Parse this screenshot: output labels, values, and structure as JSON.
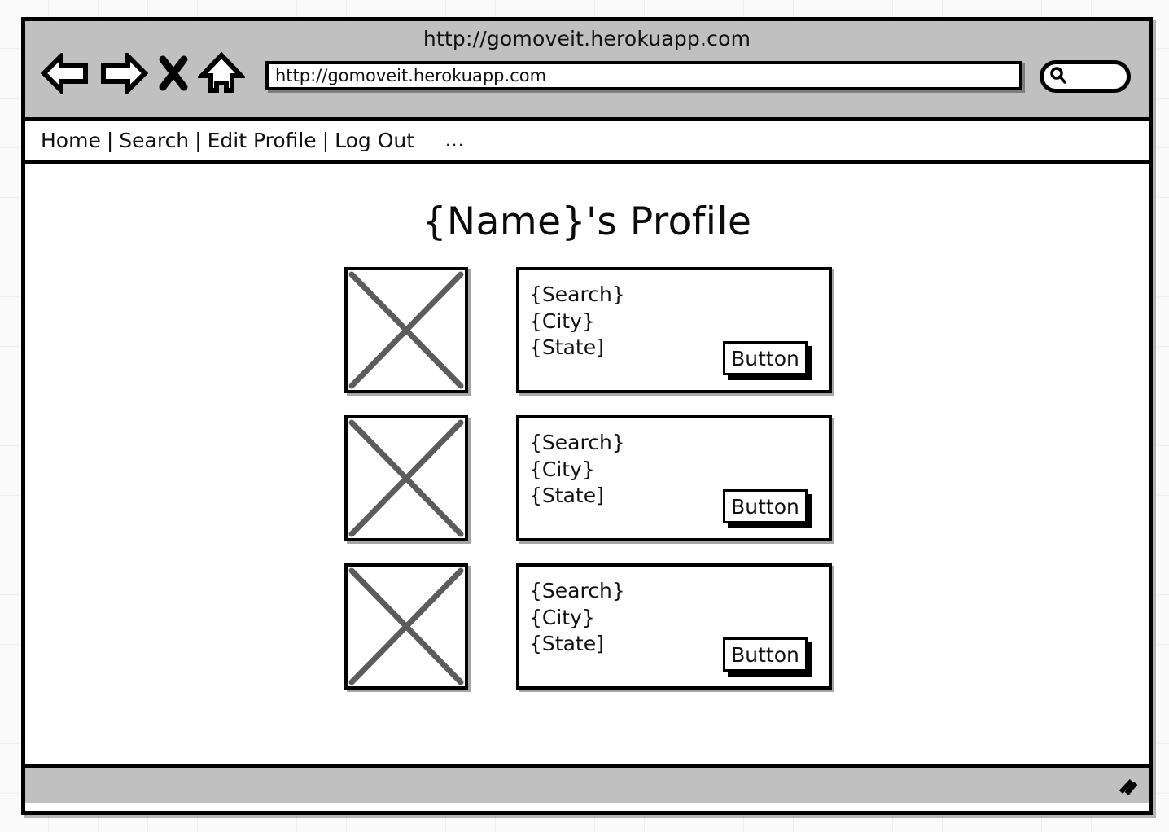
{
  "browser": {
    "window_title": "http://gomoveit.herokuapp.com",
    "address_bar": {
      "value": "http://gomoveit.herokuapp.com",
      "placeholder": "http://"
    },
    "search_box": {
      "value": "",
      "placeholder": ""
    },
    "toolbar_icons": [
      {
        "name": "back-arrow-icon",
        "label": "Back"
      },
      {
        "name": "forward-arrow-icon",
        "label": "Forward"
      },
      {
        "name": "stop-x-icon",
        "label": "Stop"
      },
      {
        "name": "home-icon",
        "label": "Home"
      }
    ],
    "status_bar": {
      "text": "",
      "resize_grip": "resize-grip-icon"
    }
  },
  "site_nav": {
    "separator": "|",
    "items": [
      {
        "label": "Home"
      },
      {
        "label": "Search"
      },
      {
        "label": "Edit Profile"
      },
      {
        "label": "Log Out"
      }
    ],
    "overflow": "..."
  },
  "main": {
    "page_title": "{Name}'s Profile",
    "cards": [
      {
        "image_placeholder": "image-placeholder",
        "lines": [
          "{Search}",
          "{City}",
          "{State]"
        ],
        "button_label": "Button"
      },
      {
        "image_placeholder": "image-placeholder",
        "lines": [
          "{Search}",
          "{City}",
          "{State]"
        ],
        "button_label": "Button"
      },
      {
        "image_placeholder": "image-placeholder",
        "lines": [
          "{Search}",
          "{City}",
          "{State]"
        ],
        "button_label": "Button"
      }
    ]
  },
  "colors": {
    "chrome_gray": "#c0c0c0",
    "outline_black": "#000000",
    "page_white": "#ffffff",
    "placeholder_x_gray": "#5c5c5c",
    "canvas_background": "#fafafa"
  }
}
